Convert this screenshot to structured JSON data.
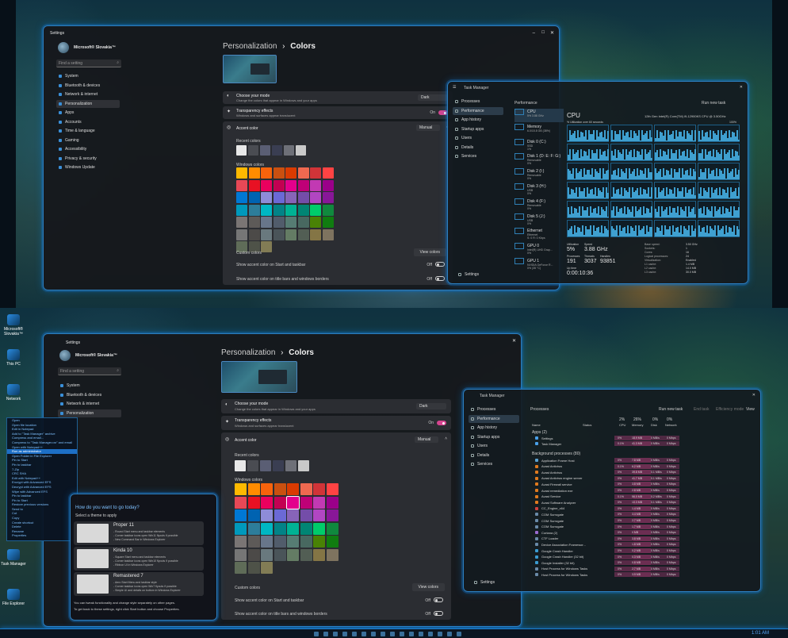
{
  "top": {
    "settings": {
      "app_title": "Settings",
      "user_name": "Microsoft® Slovakia™",
      "search_placeholder": "Find a setting",
      "nav": [
        "System",
        "Bluetooth & devices",
        "Network & internet",
        "Personalization",
        "Apps",
        "Accounts",
        "Time & language",
        "Gaming",
        "Accessibility",
        "Privacy & security",
        "Windows Update"
      ],
      "breadcrumb_parent": "Personalization",
      "breadcrumb_sep": "›",
      "page_title": "Colors",
      "mode_label": "Choose your mode",
      "mode_sub": "Change the colors that appear in Windows and your apps",
      "mode_value": "Dark",
      "transparency_label": "Transparency effects",
      "transparency_sub": "Windows and surfaces appear translucent",
      "transparency_value": "On",
      "accent_label": "Accent color",
      "accent_value": "Manual",
      "recent_label": "Recent colors",
      "windows_colors_label": "Windows colors",
      "custom_label": "Custom colors",
      "view_colors": "View colors",
      "start_label": "Show accent color on Start and taskbar",
      "start_value": "Off",
      "title_label": "Show accent color on title bars and windows borders",
      "title_value": "Off"
    },
    "taskmanager": {
      "app_title": "Task Manager",
      "nav": [
        "Processes",
        "Performance",
        "App history",
        "Startup apps",
        "Users",
        "Details",
        "Services"
      ],
      "settings": "Settings",
      "header": "Performance",
      "run_task": "Run new task",
      "items": [
        {
          "name": "CPU",
          "sub": "5% 3.88 GHz"
        },
        {
          "name": "Memory",
          "sub": "6.0/15.8 GB (38%)"
        },
        {
          "name": "Disk 0 (C:)",
          "sub": "SSD\n1%"
        },
        {
          "name": "Disk 1 (D: E: F: G:)",
          "sub": "Removable\n0%"
        },
        {
          "name": "Disk 2 (I:)",
          "sub": "Removable\n0%"
        },
        {
          "name": "Disk 3 (H:)",
          "sub": "USB\n0%"
        },
        {
          "name": "Disk 4 (F:)",
          "sub": "Removable\n0%"
        },
        {
          "name": "Disk 5 (J:)",
          "sub": "USB\n0%"
        },
        {
          "name": "Ethernet",
          "sub": "Ethernet\nS: 0 R: 0 Kbps"
        },
        {
          "name": "GPU 0",
          "sub": "Intel(R) UHD Grap...\n0%"
        },
        {
          "name": "GPU 1",
          "sub": "NVIDIA GeForce R...\n0% (35 °C)"
        }
      ],
      "cpu_title": "CPU",
      "cpu_model": "12th Gen Intel(R) Core(TM) i9-12900KS CPU @ 3.50GHz",
      "cpu_util_label": "% Utilization over 60 seconds",
      "cpu_util_max": "100%",
      "stats": {
        "utilization_label": "Utilization",
        "utilization": "5%",
        "speed_label": "Speed",
        "speed": "3.88 GHz",
        "processes_label": "Processes",
        "processes": "191",
        "threads_label": "Threads",
        "threads": "3037",
        "handles_label": "Handles",
        "handles": "93851",
        "uptime_label": "Up time",
        "uptime": "0:00:10:36"
      },
      "specs": [
        [
          "Base speed:",
          "3.50 GHz"
        ],
        [
          "Sockets:",
          "1"
        ],
        [
          "Cores:",
          "16"
        ],
        [
          "Logical processors:",
          "24"
        ],
        [
          "Virtualization:",
          "Enabled"
        ],
        [
          "L1 cache:",
          "1.4 MB"
        ],
        [
          "L2 cache:",
          "14.0 MB"
        ],
        [
          "L3 cache:",
          "30.0 MB"
        ]
      ]
    }
  },
  "bottom": {
    "settings": {
      "app_title": "Settings",
      "user_name": "Microsoft® Slovakia™",
      "search_placeholder": "Find a setting",
      "nav": [
        "System",
        "Bluetooth & devices",
        "Network & internet",
        "Personalization"
      ],
      "breadcrumb_parent": "Personalization",
      "breadcrumb_sep": "›",
      "page_title": "Colors",
      "mode_label": "Choose your mode",
      "mode_sub": "Change the colors that appear in Windows and your apps",
      "mode_value": "Dark",
      "transparency_label": "Transparency effects",
      "transparency_sub": "Windows and surfaces appear translucent",
      "transparency_value": "On",
      "accent_label": "Accent color",
      "accent_value": "Manual",
      "recent_label": "Recent colors",
      "windows_colors_label": "Windows colors",
      "custom_label": "Custom colors",
      "view_colors": "View colors",
      "start_label": "Show accent color on Start and taskbar",
      "start_value": "Off",
      "title_label": "Show accent color on title bars and windows borders",
      "title_value": "Off"
    },
    "startallback": {
      "question": "How do you want to go today?",
      "sub": "Select a theme to apply",
      "themes": [
        {
          "name": "Proper 11",
          "lines": [
            "- Round Start menu and taskbar elements",
            "- Corner taskbar icons open Win11 flyouts if possible",
            "- New Command Bar in Windows Explorer"
          ]
        },
        {
          "name": "Kinda 10",
          "lines": [
            "- Square Start menu and taskbar elements",
            "- Corner taskbar icons open Win10 flyouts if possible",
            "- Ribbon UI in Windows Explorer"
          ]
        },
        {
          "name": "Remastered 7",
          "lines": [
            "- Aero Start Menu and taskbar style",
            "- Corner taskbar icons open Win7 flyouts if possible",
            "- Simple UI and details on bottom in Windows Explorer"
          ]
        }
      ],
      "foot1": "You can tweak functionality and change style separately on other pages.",
      "foot2": "To get back to these settings, right click Start button and choose Properties."
    },
    "taskmanager": {
      "app_title": "Task Manager",
      "nav": [
        "Processes",
        "Performance",
        "App history",
        "Startup apps",
        "Users",
        "Details",
        "Services"
      ],
      "settings": "Settings",
      "header": "Processes",
      "run_task": "Run new task",
      "end_task": "End task",
      "efficiency": "Efficiency mode",
      "view": "View",
      "col_name": "Name",
      "col_status": "Status",
      "col_cpu_pct": "2%",
      "col_mem_pct": "26%",
      "col_disk_pct": "0%",
      "col_net_pct": "0%",
      "col_cpu": "CPU",
      "col_mem": "Memory",
      "col_disk": "Disk",
      "col_net": "Network",
      "apps_group": "Apps (2)",
      "bg_group": "Background processes (80)",
      "apps": [
        {
          "name": "Settings",
          "cpu": "0%",
          "mem": "18.9 MB",
          "disk": "0 MB/s",
          "net": "0 Mbps"
        },
        {
          "name": "Task Manager",
          "cpu": "0.1%",
          "mem": "41.3 MB",
          "disk": "0 MB/s",
          "net": "0 Mbps"
        }
      ],
      "bg": [
        {
          "name": "Application Frame Host",
          "cpu": "0%",
          "mem": "7.8 MB",
          "disk": "0 MB/s",
          "net": "0 Mbps"
        },
        {
          "name": "Avast Antivirus",
          "cpu": "0.1%",
          "mem": "6.2 MB",
          "disk": "0 MB/s",
          "net": "0 Mbps"
        },
        {
          "name": "Avast Antivirus",
          "cpu": "0%",
          "mem": "39.8 MB",
          "disk": "0.1 MB/s",
          "net": "0 Mbps"
        },
        {
          "name": "Avast Antivirus engine server",
          "cpu": "0%",
          "mem": "41.7 MB",
          "disk": "0.1 MB/s",
          "net": "0 Mbps"
        },
        {
          "name": "Avast Firewall service",
          "cpu": "0%",
          "mem": "3.8 MB",
          "disk": "0 MB/s",
          "net": "0 Mbps"
        },
        {
          "name": "Avast remediation exe",
          "cpu": "0%",
          "mem": "2.8 MB",
          "disk": "0 MB/s",
          "net": "0 Mbps"
        },
        {
          "name": "Avast Service",
          "cpu": "0.1%",
          "mem": "56.0 MB",
          "disk": "0.2 MB/s",
          "net": "0 Mbps"
        },
        {
          "name": "Avast Software Analyzer",
          "cpu": "0%",
          "mem": "10.3 MB",
          "disk": "0.1 MB/s",
          "net": "0 Mbps"
        },
        {
          "name": "CC_Engine_x64",
          "cpu": "0%",
          "mem": "1.4 MB",
          "disk": "0 MB/s",
          "net": "0 Mbps"
        },
        {
          "name": "COM Surrogate",
          "cpu": "0%",
          "mem": "3.4 MB",
          "disk": "0 MB/s",
          "net": "0 Mbps"
        },
        {
          "name": "COM Surrogate",
          "cpu": "0%",
          "mem": "2.7 MB",
          "disk": "0 MB/s",
          "net": "0 Mbps"
        },
        {
          "name": "COM Surrogate",
          "cpu": "0%",
          "mem": "1.7 MB",
          "disk": "0 MB/s",
          "net": "0 Mbps"
        },
        {
          "name": "Cortana (2)",
          "cpu": "0%",
          "mem": "0 MB",
          "disk": "0 MB/s",
          "net": "0 Mbps"
        },
        {
          "name": "CTF Loader",
          "cpu": "0%",
          "mem": "3.8 MB",
          "disk": "0 MB/s",
          "net": "0 Mbps"
        },
        {
          "name": "Device Association Framewor...",
          "cpu": "0%",
          "mem": "1.8 MB",
          "disk": "0 MB/s",
          "net": "0 Mbps"
        },
        {
          "name": "Google Crash Handler",
          "cpu": "0%",
          "mem": "0.2 MB",
          "disk": "0 MB/s",
          "net": "0 Mbps"
        },
        {
          "name": "Google Crash Handler (32 bit)",
          "cpu": "0%",
          "mem": "0.3 MB",
          "disk": "0 MB/s",
          "net": "0 Mbps"
        },
        {
          "name": "Google Installer (32 bit)",
          "cpu": "0%",
          "mem": "0.8 MB",
          "disk": "0 MB/s",
          "net": "0 Mbps"
        },
        {
          "name": "Host Process for Windows Tasks",
          "cpu": "0%",
          "mem": "2.7 MB",
          "disk": "0 MB/s",
          "net": "0 Mbps"
        },
        {
          "name": "Host Process for Windows Tasks",
          "cpu": "0%",
          "mem": "3.9 MB",
          "disk": "0 MB/s",
          "net": "0 Mbps"
        }
      ]
    },
    "desktop": [
      {
        "label": "Microsoft®\nSlovakia™"
      },
      {
        "label": "This PC"
      },
      {
        "label": "Network"
      },
      {
        "label": "Task Manager"
      },
      {
        "label": "File Explorer"
      }
    ],
    "context_menu": [
      "Open",
      "Open file location",
      "Edit in Notepad",
      "Add to \"Task Manager\" archive",
      "Compress and email...",
      "Compress to \"Task Manager.rar\" and email",
      "Open with Notepad++",
      "Run as administrator",
      "Open Folder in File Explorer",
      "Pin to Start",
      "Pin to taskbar",
      "7-Zip",
      "CRC SHA",
      "Edit with Notepad++",
      "Encrypt with Advanced EFS",
      "Decrypt with Advanced EFS",
      "Wipe with Advanced EFS",
      "Pin to taskbar",
      "Pin to Start",
      "Restore previous versions",
      "Send to",
      "Cut",
      "Copy",
      "Create shortcut",
      "Delete",
      "Rename",
      "Properties"
    ],
    "clock": "1:01 AM"
  },
  "colors": {
    "accent": "#d6448f",
    "border_glow": "#2d7fc0",
    "window_bg": "#16181c",
    "recent_colors": [
      "#e8e8e8",
      "#4a4c52",
      "#5a5e74",
      "#3a3e52",
      "#6e7078",
      "#c9c9c9"
    ],
    "windows_colors": [
      "#ffb900",
      "#ff8c00",
      "#f7630c",
      "#ca5010",
      "#da3b01",
      "#ef6950",
      "#d13438",
      "#ff4343",
      "#e74856",
      "#e81123",
      "#ea005e",
      "#c30052",
      "#e3008c",
      "#bf0077",
      "#c239b3",
      "#9a0089",
      "#0078d4",
      "#0063b1",
      "#8e8cd8",
      "#6b69d6",
      "#8764b8",
      "#744da9",
      "#b146c2",
      "#881798",
      "#0099bc",
      "#2d7d9a",
      "#00b7c3",
      "#038387",
      "#00b294",
      "#018574",
      "#00cc6a",
      "#10893e",
      "#7a7574",
      "#5d5a58",
      "#68768a",
      "#515c6b",
      "#567c73",
      "#486860",
      "#498205",
      "#107c10",
      "#767676",
      "#4c4a48",
      "#69797e",
      "#4a5459",
      "#647c64",
      "#525e54",
      "#847545",
      "#7e735f"
    ],
    "selected_swatch_index": 12
  }
}
